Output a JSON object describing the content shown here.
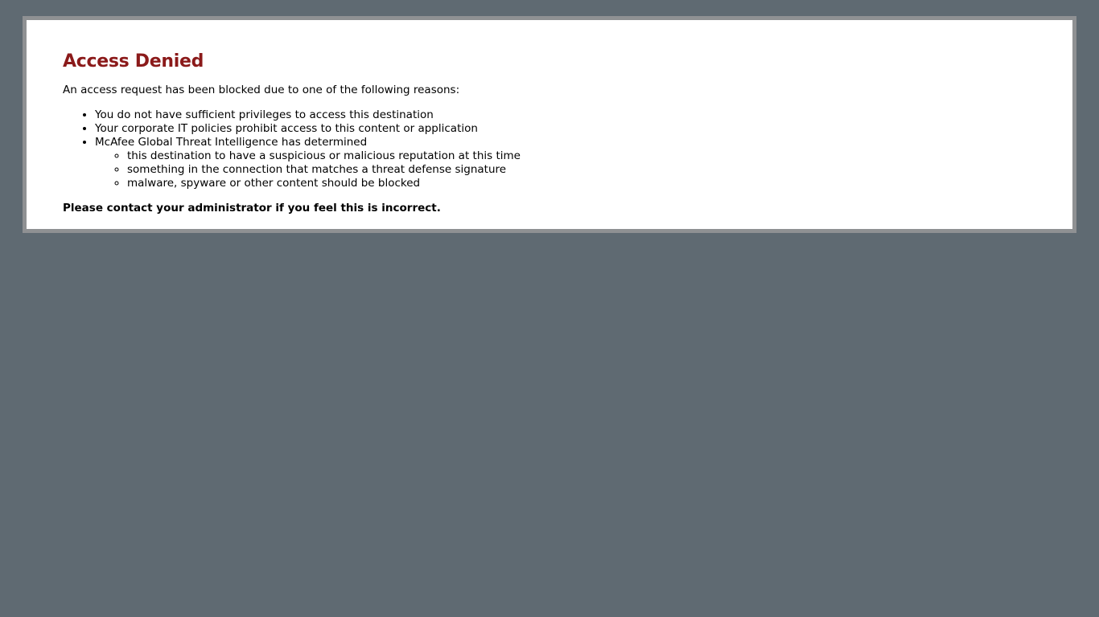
{
  "title": "Access Denied",
  "intro": "An access request has been blocked due to one of the following reasons:",
  "reasons": [
    "You do not have sufficient privileges to access this destination",
    "Your corporate IT policies prohibit access to this content or application",
    "McAfee Global Threat Intelligence has determined"
  ],
  "sub_reasons": [
    "this destination to have a suspicious or malicious reputation at this time",
    "something in the connection that matches a threat defense signature",
    "malware, spyware or other content should be blocked"
  ],
  "contact_note": "Please contact your administrator if you feel this is incorrect.",
  "colors": {
    "background": "#5f6a72",
    "panel": "#ffffff",
    "panel_border": "#8f9193",
    "title": "#8b1a1a"
  }
}
